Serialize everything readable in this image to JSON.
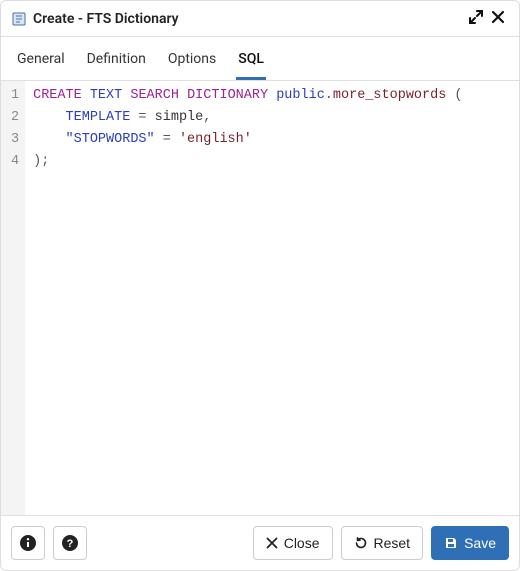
{
  "dialog": {
    "title": "Create - FTS Dictionary"
  },
  "tabs": [
    {
      "label": "General",
      "active": false
    },
    {
      "label": "Definition",
      "active": false
    },
    {
      "label": "Options",
      "active": false
    },
    {
      "label": "SQL",
      "active": true
    }
  ],
  "code": {
    "lines": [
      "1",
      "2",
      "3",
      "4"
    ],
    "line1": {
      "a": "CREATE",
      "b": "TEXT",
      "c": "SEARCH",
      "d": "DICTIONARY",
      "e": "public",
      "dot": ".",
      "f": "more_stopwords",
      "g": " ("
    },
    "line2": {
      "indent": "    ",
      "a": "TEMPLATE",
      "eq": " = ",
      "b": "simple",
      "comma": ","
    },
    "line3": {
      "indent": "    ",
      "a": "\"STOPWORDS\"",
      "eq": " = ",
      "b": "'english'"
    },
    "line4": {
      "a": ");"
    }
  },
  "footer": {
    "close": "Close",
    "reset": "Reset",
    "save": "Save"
  }
}
